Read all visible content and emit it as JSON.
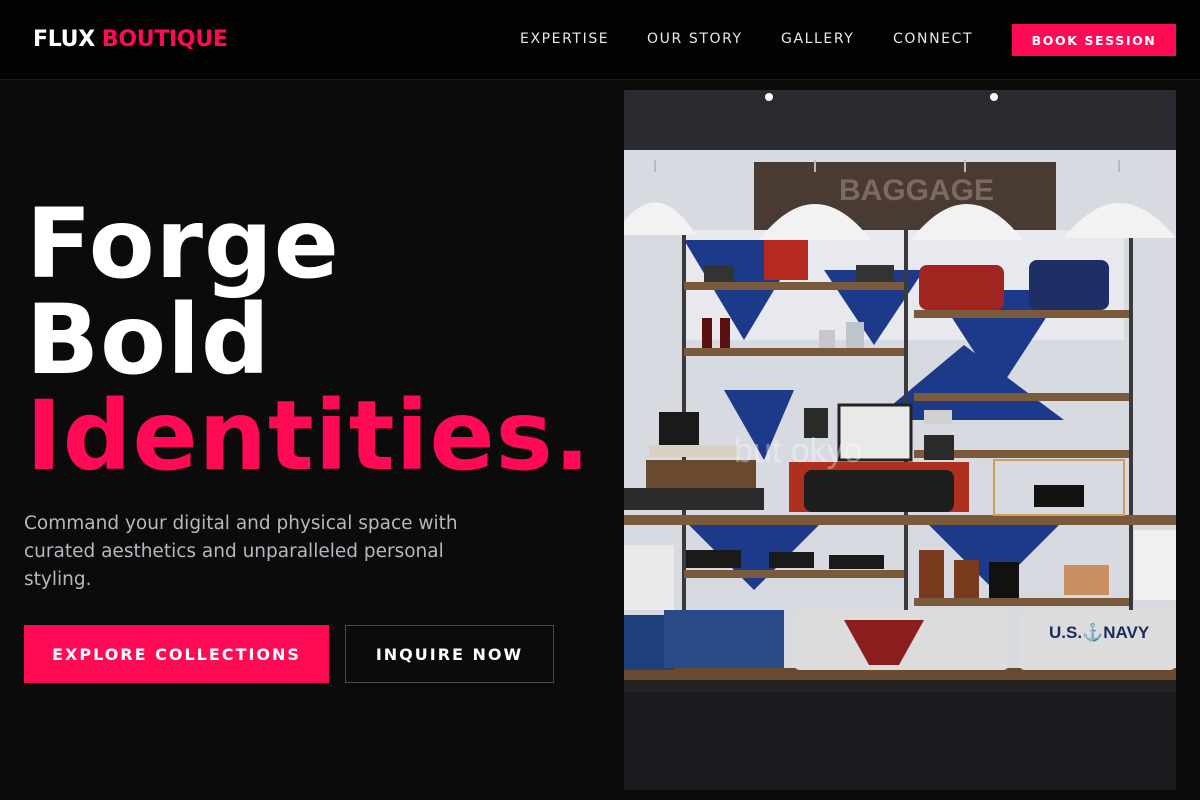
{
  "brand": {
    "part1": "FLUX",
    "part2": "BOUTIQUE",
    "accent_color": "#ff0a55"
  },
  "nav": {
    "links": [
      "EXPERTISE",
      "OUR STORY",
      "GALLERY",
      "CONNECT"
    ],
    "cta": "BOOK SESSION"
  },
  "hero": {
    "headline_line1": "Forge",
    "headline_line2": "Bold",
    "headline_line3": "Identities.",
    "subtext": "Command your digital and physical space with curated aesthetics and unparalleled personal styling.",
    "primary_button": "EXPLORE COLLECTIONS",
    "secondary_button": "INQUIRE NOW"
  },
  "photo": {
    "description_icon": "boutique-store-photo",
    "sign_text": "BAGGAGE",
    "shirt_text": "U.S.⚓NAVY",
    "watermark": "but      okyo"
  }
}
